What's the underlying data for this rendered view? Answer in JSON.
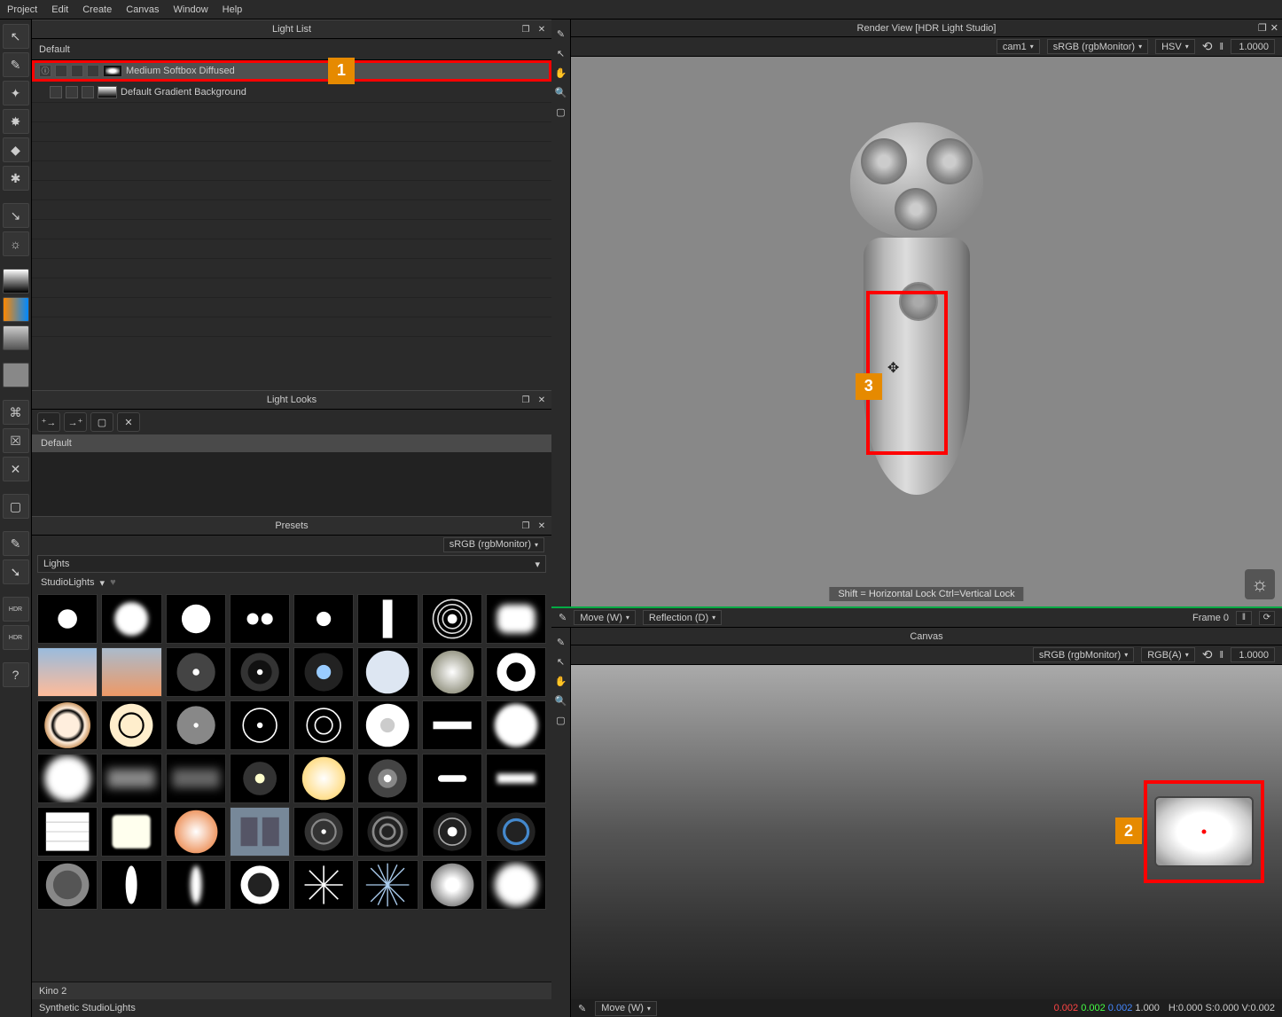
{
  "menubar": [
    "Project",
    "Edit",
    "Create",
    "Canvas",
    "Window",
    "Help"
  ],
  "lightlist": {
    "title": "Light List",
    "default_label": "Default",
    "items": [
      {
        "name": "Medium Softbox Diffused",
        "selected": true
      },
      {
        "name": "Default Gradient Background",
        "selected": false
      }
    ]
  },
  "lightlooks": {
    "title": "Light Looks",
    "default_row": "Default"
  },
  "presets": {
    "title": "Presets",
    "colorspace": "sRGB (rgbMonitor)",
    "category": "Lights",
    "subcategory": "StudioLights",
    "hover_label": "Kino 2",
    "footer": "Synthetic StudioLights"
  },
  "renderview": {
    "title": "Render View [HDR Light Studio]",
    "camera": "cam1",
    "colorspace": "sRGB (rgbMonitor)",
    "mode": "HSV",
    "value": "1.0000",
    "hint": "Shift = Horizontal Lock   Ctrl=Vertical Lock"
  },
  "transport": {
    "move": "Move (W)",
    "reflection": "Reflection (D)",
    "frame": "Frame 0"
  },
  "canvas": {
    "title": "Canvas",
    "colorspace": "sRGB (rgbMonitor)",
    "mode": "RGB(A)",
    "value": "1.0000",
    "move": "Move (W)",
    "rgb": {
      "r": "0.002",
      "g": "0.002",
      "b": "0.002",
      "ext": "1.000"
    },
    "hsv": "H:0.000 S:0.000 V:0.002"
  },
  "callouts": {
    "c1": "1",
    "c2": "2",
    "c3": "3"
  }
}
